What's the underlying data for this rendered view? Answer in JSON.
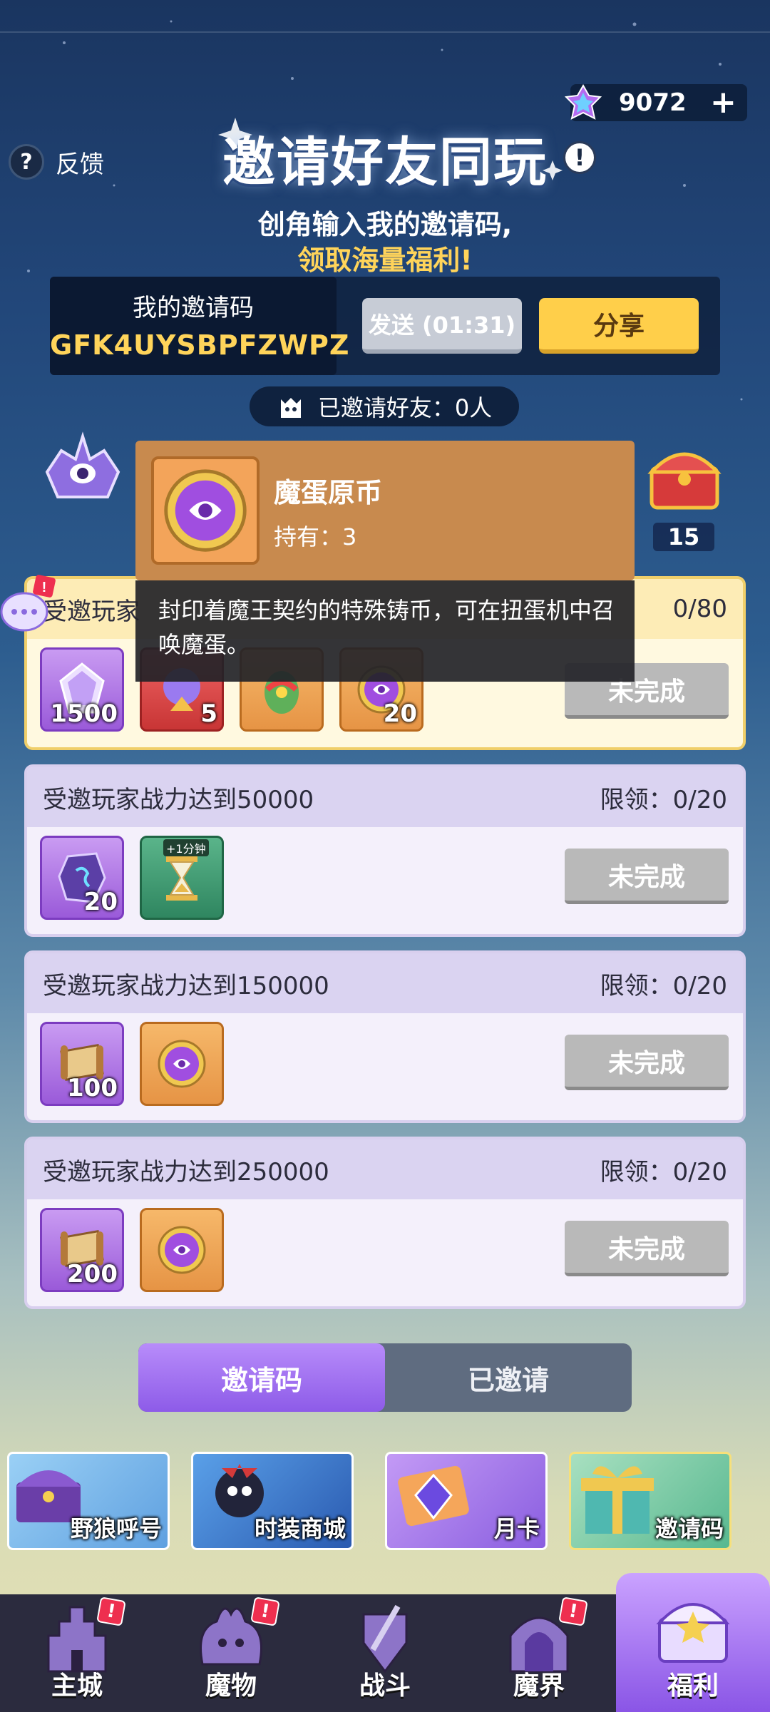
{
  "header": {
    "currency_value": "9072",
    "currency_plus": "+",
    "feedback_label": "反馈",
    "title": "邀请好友同玩",
    "subtitle_line1": "创角输入我的邀请码,",
    "subtitle_line2": "领取海量福利!"
  },
  "invite": {
    "code_label": "我的邀请码",
    "code_value": "GFK4UYSBPFZWPZ",
    "send_label": "发送 (01:31)",
    "share_label": "分享",
    "invited_count": "已邀请好友：0人"
  },
  "progress": {
    "right_count": "15"
  },
  "tooltip": {
    "item_name": "魔蛋原币",
    "holding": "持有：3",
    "description": "封印着魔王契约的特殊铸币，可在扭蛋机中召唤魔蛋。"
  },
  "tasks": [
    {
      "title": "受邀玩家",
      "limit": "0/80",
      "rewards": [
        {
          "qty": "1500",
          "color": "purple",
          "icon": "crystal-icon"
        },
        {
          "qty": "5",
          "color": "red",
          "icon": "summon-orb-icon"
        },
        {
          "qty": "",
          "color": "orange",
          "icon": "egg-icon"
        },
        {
          "qty": "20",
          "color": "orange",
          "icon": "demon-coin-icon"
        }
      ],
      "button": "未完成"
    },
    {
      "title": "受邀玩家战力达到50000",
      "limit": "限领：0/20",
      "rewards": [
        {
          "qty": "20",
          "color": "purple",
          "icon": "rune-stone-icon"
        },
        {
          "qty": "",
          "color": "green",
          "icon": "hourglass-icon",
          "tag": "+1分钟"
        }
      ],
      "button": "未完成"
    },
    {
      "title": "受邀玩家战力达到150000",
      "limit": "限领：0/20",
      "rewards": [
        {
          "qty": "100",
          "color": "purple",
          "icon": "scroll-icon"
        },
        {
          "qty": "",
          "color": "orange",
          "icon": "demon-coin-icon"
        }
      ],
      "button": "未完成"
    },
    {
      "title": "受邀玩家战力达到250000",
      "limit": "限领：0/20",
      "rewards": [
        {
          "qty": "200",
          "color": "purple",
          "icon": "scroll-icon"
        },
        {
          "qty": "",
          "color": "orange",
          "icon": "demon-coin-icon"
        }
      ],
      "button": "未完成"
    }
  ],
  "tabs": {
    "active": "邀请码",
    "inactive": "已邀请"
  },
  "banners": [
    {
      "label": "野狼呼号"
    },
    {
      "label": "时装商城"
    },
    {
      "label": "月卡"
    },
    {
      "label": "邀请码"
    }
  ],
  "nav": [
    {
      "label": "主城",
      "badge": "!"
    },
    {
      "label": "魔物",
      "badge": "!"
    },
    {
      "label": "战斗",
      "badge": ""
    },
    {
      "label": "魔界",
      "badge": "!"
    },
    {
      "label": "福利",
      "badge": ""
    }
  ],
  "colors": {
    "accent_gold": "#ffd45a",
    "tab_purple": "#8d5be8",
    "button_gray": "#b9b9b9"
  }
}
